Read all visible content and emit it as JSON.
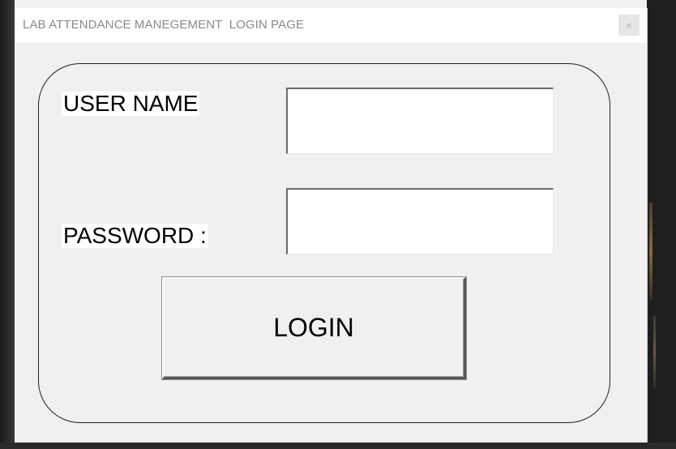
{
  "window": {
    "title": "LAB ATTENDANCE MANEGEMENT  LOGIN PAGE",
    "close_glyph": "×"
  },
  "form": {
    "username_label": "USER NAME",
    "username_value": "",
    "password_label": "PASSWORD :",
    "password_value": "",
    "login_label": "LOGIN"
  },
  "colors": {
    "window_bg": "#f0f0f0",
    "titlebar_bg": "#ffffff",
    "title_text": "#8a8a8a",
    "frame_border": "#202020"
  },
  "icons": {
    "close": "close-icon"
  }
}
